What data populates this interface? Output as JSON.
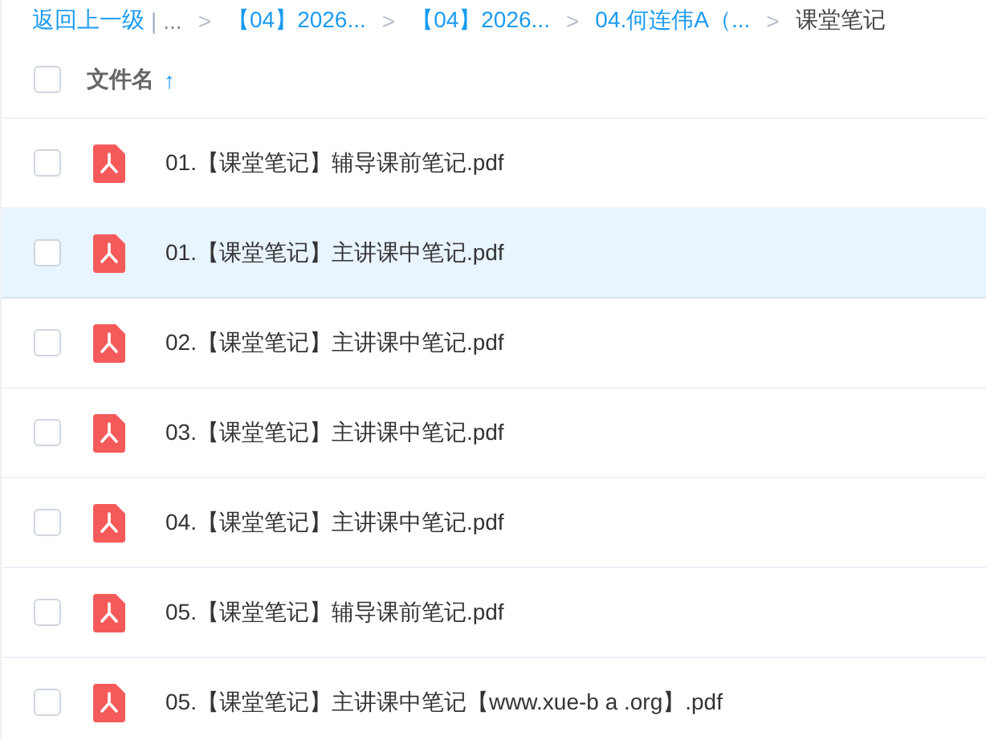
{
  "breadcrumb": [
    {
      "kind": "link",
      "text": "返回上一级"
    },
    {
      "kind": "bar",
      "text": "|"
    },
    {
      "kind": "muted",
      "text": "..."
    },
    {
      "kind": "sep",
      "text": ">"
    },
    {
      "kind": "link",
      "text": "【04】2026..."
    },
    {
      "kind": "sep",
      "text": ">"
    },
    {
      "kind": "link",
      "text": "【04】2026..."
    },
    {
      "kind": "sep",
      "text": ">"
    },
    {
      "kind": "link",
      "text": "04.何连伟A（..."
    },
    {
      "kind": "sep",
      "text": ">"
    },
    {
      "kind": "current",
      "text": "课堂笔记"
    }
  ],
  "header": {
    "checked": false,
    "label": "文件名",
    "sort_arrow": "↑"
  },
  "files": [
    {
      "name": "01.【课堂笔记】辅导课前笔记.pdf",
      "checked": false,
      "highlighted": false
    },
    {
      "name": "01.【课堂笔记】主讲课中笔记.pdf",
      "checked": false,
      "highlighted": true
    },
    {
      "name": "02.【课堂笔记】主讲课中笔记.pdf",
      "checked": false,
      "highlighted": false
    },
    {
      "name": "03.【课堂笔记】主讲课中笔记.pdf",
      "checked": false,
      "highlighted": false
    },
    {
      "name": "04.【课堂笔记】主讲课中笔记.pdf",
      "checked": false,
      "highlighted": false
    },
    {
      "name": "05.【课堂笔记】辅导课前笔记.pdf",
      "checked": false,
      "highlighted": false
    },
    {
      "name": "05.【课堂笔记】主讲课中笔记【www.xue-b a .org】.pdf",
      "checked": false,
      "highlighted": false
    }
  ]
}
